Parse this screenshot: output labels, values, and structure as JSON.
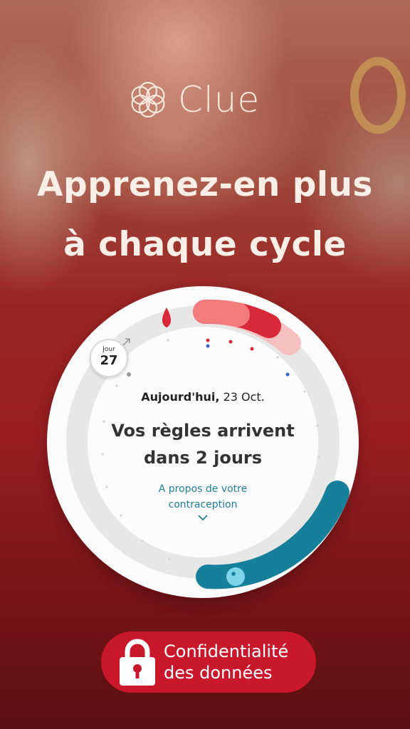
{
  "brand": {
    "name": "Clue"
  },
  "headline": {
    "line1": "Apprenez-en plus",
    "line2": "à chaque cycle"
  },
  "cycle_card": {
    "day_label": "Jour",
    "day_number": "27",
    "today_prefix": "Aujourd'hui,",
    "today_date": "23 Oct.",
    "message_line1": "Vos règles arrivent",
    "message_line2": "dans 2 jours",
    "link_line1": "A propos de votre",
    "link_line2": "contraception"
  },
  "privacy_button": {
    "line1": "Confidentialité",
    "line2": "des données"
  },
  "colors": {
    "period_red": "#d62839",
    "period_light": "#f6b3b3",
    "fertile_teal": "#167f99",
    "ring_gray": "#e7e7e7",
    "button_red": "#c9172c"
  }
}
